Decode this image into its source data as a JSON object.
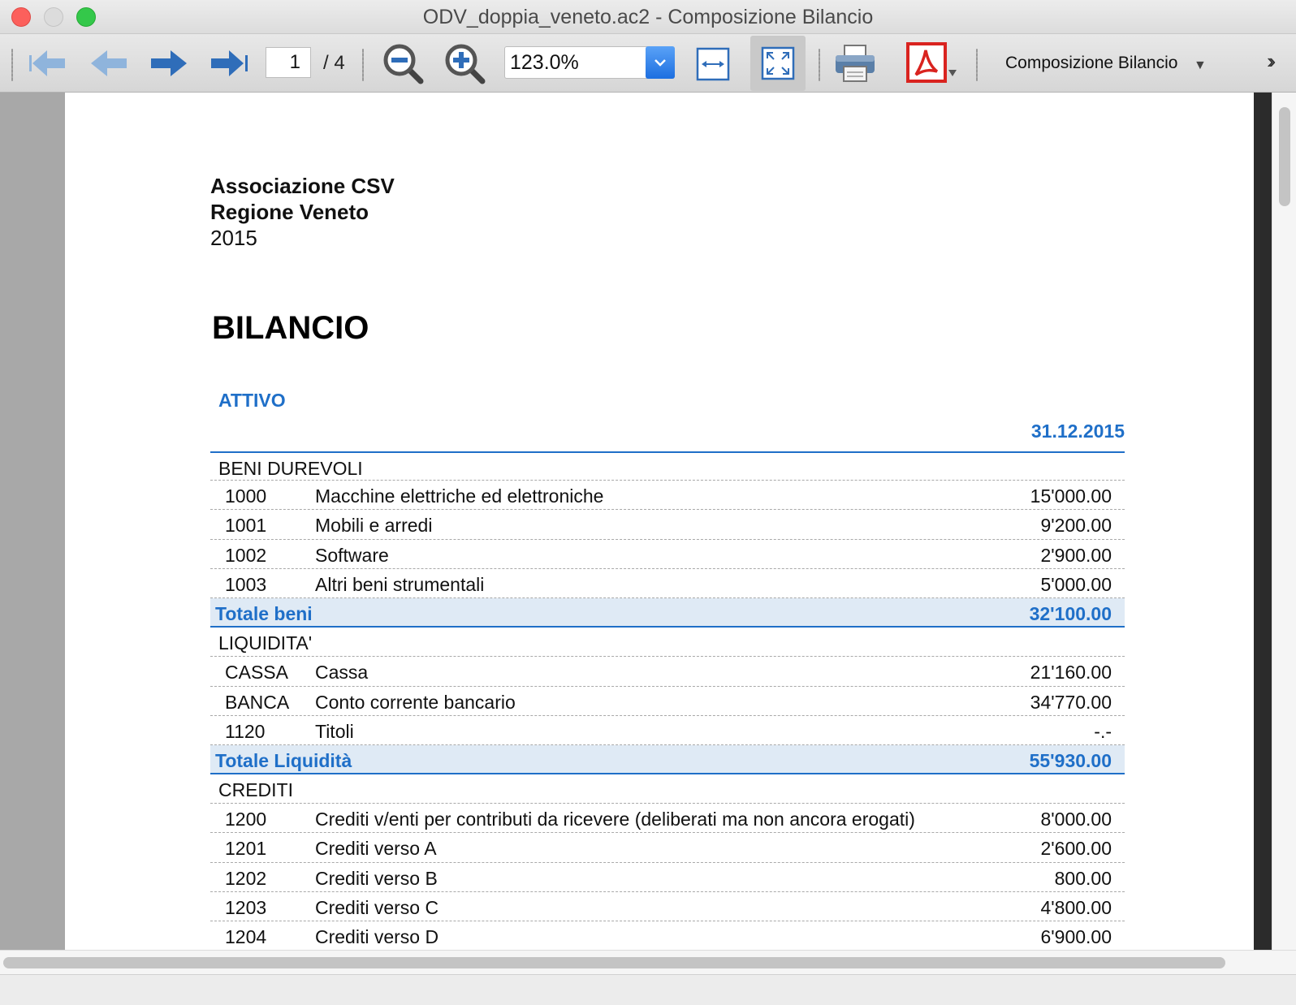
{
  "window": {
    "title": "ODV_doppia_veneto.ac2 - Composizione Bilancio"
  },
  "toolbar": {
    "first_page_icon": "arrow-first-icon",
    "prev_page_icon": "arrow-left-icon",
    "next_page_icon": "arrow-right-icon",
    "last_page_icon": "arrow-last-icon",
    "current_page": "1",
    "total_pages": "/ 4",
    "zoom_value": "123.0%",
    "view_name": "Composizione Bilancio",
    "accent": "#1d6fe0"
  },
  "document": {
    "org_line1": "Associazione CSV",
    "org_line2": "Regione Veneto",
    "year": "2015",
    "title": "BILANCIO",
    "section": "ATTIVO",
    "column_date": "31.12.2015",
    "accent": "#1f6fc8",
    "groups": [
      {
        "title": "BENI DUREVOLI",
        "rows": [
          {
            "code": "1000",
            "desc": "Macchine elettriche ed elettroniche",
            "amount": "15'000.00"
          },
          {
            "code": "1001",
            "desc": "Mobili e arredi",
            "amount": "9'200.00"
          },
          {
            "code": "1002",
            "desc": "Software",
            "amount": "2'900.00"
          },
          {
            "code": "1003",
            "desc": "Altri beni strumentali",
            "amount": "5'000.00"
          }
        ],
        "total_label": "Totale beni",
        "total_amount": "32'100.00"
      },
      {
        "title": "LIQUIDITA'",
        "rows": [
          {
            "code": "CASSA",
            "desc": "Cassa",
            "amount": "21'160.00"
          },
          {
            "code": "BANCA",
            "desc": "Conto corrente bancario",
            "amount": "34'770.00"
          },
          {
            "code": "1120",
            "desc": "Titoli",
            "amount": "-.-"
          }
        ],
        "total_label": "Totale Liquidità",
        "total_amount": "55'930.00"
      },
      {
        "title": "CREDITI",
        "rows": [
          {
            "code": "1200",
            "desc": "Crediti v/enti per contributi da ricevere (deliberati ma non ancora erogati)",
            "amount": "8'000.00"
          },
          {
            "code": "1201",
            "desc": "Crediti verso A",
            "amount": "2'600.00"
          },
          {
            "code": "1202",
            "desc": "Crediti verso B",
            "amount": "800.00"
          },
          {
            "code": "1203",
            "desc": "Crediti verso C",
            "amount": "4'800.00"
          },
          {
            "code": "1204",
            "desc": "Crediti verso D",
            "amount": "6'900.00"
          }
        ]
      }
    ]
  }
}
